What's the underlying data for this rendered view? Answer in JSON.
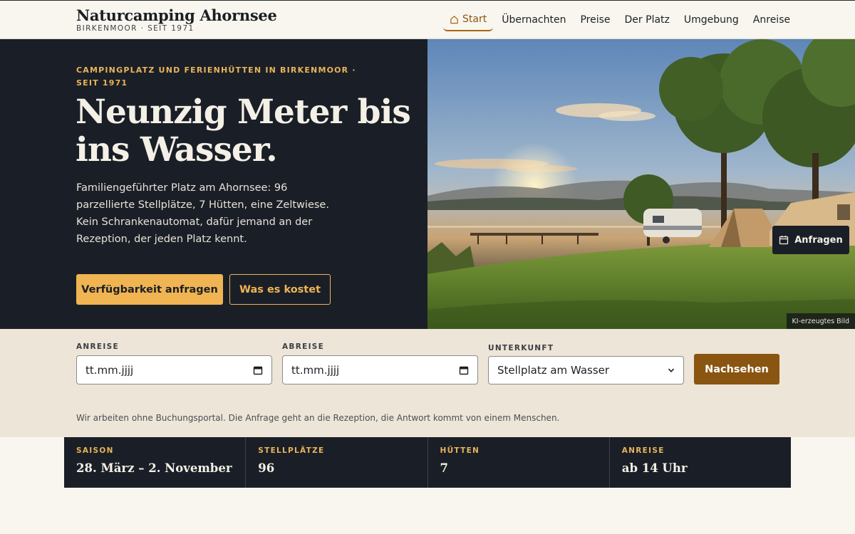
{
  "brand": {
    "name": "Naturcamping Ahornsee",
    "subtitle": "BIRKENMOOR · SEIT 1971"
  },
  "nav": {
    "items": [
      {
        "label": "Start",
        "icon": "home-icon",
        "active": true
      },
      {
        "label": "Übernachten"
      },
      {
        "label": "Preise"
      },
      {
        "label": "Der Platz"
      },
      {
        "label": "Umgebung"
      },
      {
        "label": "Anreise"
      }
    ]
  },
  "hero": {
    "eyebrow": "CAMPINGPLATZ UND FERIENHÜTTEN IN BIRKENMOOR · SEIT 1971",
    "headline": "Neunzig Meter bis ins Wasser.",
    "lead": "Familiengeführter Platz am Ahornsee: 96 parzellierte Stellplätze, 7 Hütten, eine Zeltwiese. Kein Schrankenautomat, dafür jemand an der Rezeption, der jeden Platz kennt.",
    "primary_cta": "Verfügbarkeit anfragen",
    "secondary_cta": "Was es kostet",
    "float_button": "Anfragen",
    "image_badge": "KI-erzeugtes Bild"
  },
  "booking": {
    "arrival_label": "ANREISE",
    "arrival_placeholder": "tt.mm.jjjj",
    "departure_label": "ABREISE",
    "departure_placeholder": "tt.mm.jjjj",
    "lodging_label": "UNTERKUNFT",
    "lodging_value": "Stellplatz am Wasser",
    "submit": "Nachsehen",
    "note": "Wir arbeiten ohne Buchungsportal. Die Anfrage geht an die Rezeption, die Antwort kommt von einem Menschen."
  },
  "facts": [
    {
      "label": "SAISON",
      "value": "28. März – 2. November"
    },
    {
      "label": "STELLPLÄTZE",
      "value": "96"
    },
    {
      "label": "HÜTTEN",
      "value": "7"
    },
    {
      "label": "ANREISE",
      "value": "ab 14 Uhr"
    }
  ],
  "colors": {
    "dark": "#1a1f27",
    "accent": "#f0b453",
    "accent_dark": "#8a5511",
    "sand": "#ede5d7",
    "page": "#f9f6ef"
  }
}
